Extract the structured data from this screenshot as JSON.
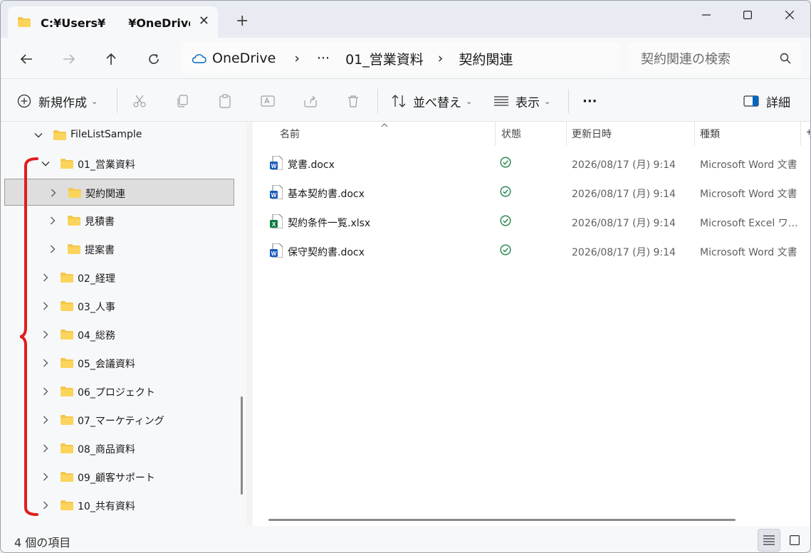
{
  "window": {
    "tab_title": "C:¥Users¥　　¥OneDrive¥",
    "tab_close": "✕",
    "new_tab": "+"
  },
  "address": {
    "crumbs": [
      "OneDrive",
      "›",
      "···",
      "01_営業資料",
      "›",
      "契約関連"
    ],
    "search_placeholder": "契約関連の検索"
  },
  "toolbar": {
    "new_label": "新規作成",
    "sort_label": "並べ替え",
    "view_label": "表示",
    "more_label": "···",
    "details_label": "詳細"
  },
  "sidebar": {
    "items": [
      {
        "label": "FileListSample",
        "expanded": true
      },
      {
        "label": "01_営業資料",
        "expanded": true
      },
      {
        "label": "契約関連",
        "selected": true
      },
      {
        "label": "見積書"
      },
      {
        "label": "提案書"
      },
      {
        "label": "02_経理"
      },
      {
        "label": "03_人事"
      },
      {
        "label": "04_総務"
      },
      {
        "label": "05_会議資料"
      },
      {
        "label": "06_プロジェクト"
      },
      {
        "label": "07_マーケティング"
      },
      {
        "label": "08_商品資料"
      },
      {
        "label": "09_顧客サポート"
      },
      {
        "label": "10_共有資料"
      }
    ]
  },
  "columns": {
    "name": "名前",
    "status": "状態",
    "date": "更新日時",
    "type": "種類",
    "size": "サ"
  },
  "files": [
    {
      "name": "覚書.docx",
      "date": "2026/08/17 (月) 9:14",
      "type": "Microsoft Word 文書",
      "kind": "word"
    },
    {
      "name": "基本契約書.docx",
      "date": "2026/08/17 (月) 9:14",
      "type": "Microsoft Word 文書",
      "kind": "word"
    },
    {
      "name": "契約条件一覧.xlsx",
      "date": "2026/08/17 (月) 9:14",
      "type": "Microsoft Excel ワークシート",
      "kind": "excel"
    },
    {
      "name": "保守契約書.docx",
      "date": "2026/08/17 (月) 9:14",
      "type": "Microsoft Word 文書",
      "kind": "word"
    }
  ],
  "status_bar": {
    "item_count": "4 個の項目"
  },
  "colors": {
    "accent": "#0067c0",
    "folder": "#f4c64a",
    "bracket": "#e11d1d",
    "status_ok": "#2e8b57"
  }
}
